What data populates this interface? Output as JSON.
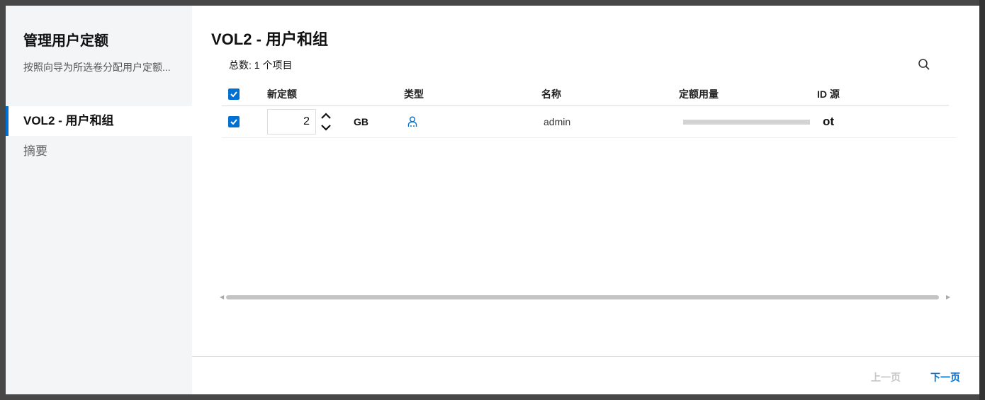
{
  "sidebar": {
    "title": "管理用户定额",
    "description": "按照向导为所选卷分配用户定额...",
    "steps": [
      {
        "label": "VOL2 - 用户和组"
      },
      {
        "label": "摘要"
      }
    ]
  },
  "main": {
    "title": "VOL2 - 用户和组",
    "count": "总数: 1 个项目",
    "columns": [
      "新定额",
      "类型",
      "名称",
      "定额用量",
      "ID 源"
    ],
    "rows": [
      {
        "checked": true,
        "quota": "2",
        "unit": "GB",
        "type": "user",
        "name": "admin",
        "usage_percent": 0,
        "id_source": "ot"
      }
    ]
  },
  "footer": {
    "prev": "上一页",
    "next": "下一页"
  },
  "colors": {
    "accent": "#0070d2"
  }
}
